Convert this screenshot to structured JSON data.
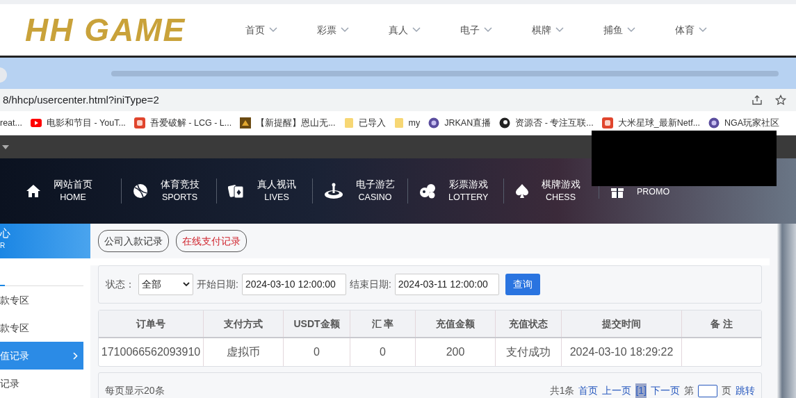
{
  "site_header": {
    "logo": "HH GAME",
    "nav": [
      {
        "label": "首页"
      },
      {
        "label": "彩票"
      },
      {
        "label": "真人"
      },
      {
        "label": "电子"
      },
      {
        "label": "棋牌"
      },
      {
        "label": "捕鱼"
      },
      {
        "label": "体育"
      }
    ]
  },
  "browser": {
    "url": "8/hhcp/usercenter.html?iniType=2",
    "bookmarks": [
      {
        "label": "reat...",
        "kind": "none"
      },
      {
        "label": "电影和节目 - YouT...",
        "kind": "play"
      },
      {
        "label": "吾爱破解 - LCG - L...",
        "kind": "badge"
      },
      {
        "label": "【新提醒】恩山无...",
        "kind": "square"
      },
      {
        "label": "已导入",
        "kind": "folder"
      },
      {
        "label": "my",
        "kind": "folder"
      },
      {
        "label": "JRKAN直播",
        "kind": "orb"
      },
      {
        "label": "资源否 - 专注互联...",
        "kind": "dark"
      },
      {
        "label": "大米星球_最新Netf...",
        "kind": "badge"
      },
      {
        "label": "NGA玩家社区",
        "kind": "orb"
      }
    ]
  },
  "main_nav": [
    {
      "title": "网站首页",
      "subtitle": "HOME",
      "kind": "home"
    },
    {
      "title": "体育竞技",
      "subtitle": "SPORTS",
      "kind": "ball"
    },
    {
      "title": "真人视讯",
      "subtitle": "LIVES",
      "kind": "cards"
    },
    {
      "title": "电子游艺",
      "subtitle": "CASINO",
      "kind": "slot"
    },
    {
      "title": "彩票游戏",
      "subtitle": "LOTTERY",
      "kind": "balls"
    },
    {
      "title": "棋牌游戏",
      "subtitle": "CHESS",
      "kind": "spade"
    },
    {
      "subtitle": "PROMO",
      "kind": "gift"
    }
  ],
  "sidebar": {
    "header_title": "心",
    "header_subtitle": "R",
    "items": [
      {
        "label": "款专区",
        "selected": false
      },
      {
        "label": "款专区",
        "selected": false
      },
      {
        "label": "值记录",
        "selected": true
      },
      {
        "label": "记录",
        "selected": false
      }
    ]
  },
  "record_tabs": [
    {
      "label": "公司入款记录",
      "selected": false
    },
    {
      "label": "在线支付记录",
      "selected": true
    }
  ],
  "filter": {
    "status_label": "状态：",
    "status_value": "全部",
    "start_label": "开始日期:",
    "start_value": "2024-03-10 12:00:00",
    "end_label": "结束日期:",
    "end_value": "2024-03-11 12:00:00",
    "button": "查询"
  },
  "table": {
    "columns": [
      "订单号",
      "支付方式",
      "USDT金额",
      "汇 率",
      "充值金额",
      "充值状态",
      "提交时间",
      "备 注"
    ],
    "rows": [
      [
        "1710066562093910",
        "虚拟币",
        "0",
        "0",
        "200",
        "支付成功",
        "2024-03-10 18:29:22",
        ""
      ]
    ]
  },
  "pagination": {
    "per_page": "每页显示20条",
    "total": "共1条",
    "first": "首页",
    "prev": "上一页",
    "current": "[1]",
    "next": "下一页",
    "page_before": "第",
    "page_after": "页",
    "go": "跳转"
  }
}
